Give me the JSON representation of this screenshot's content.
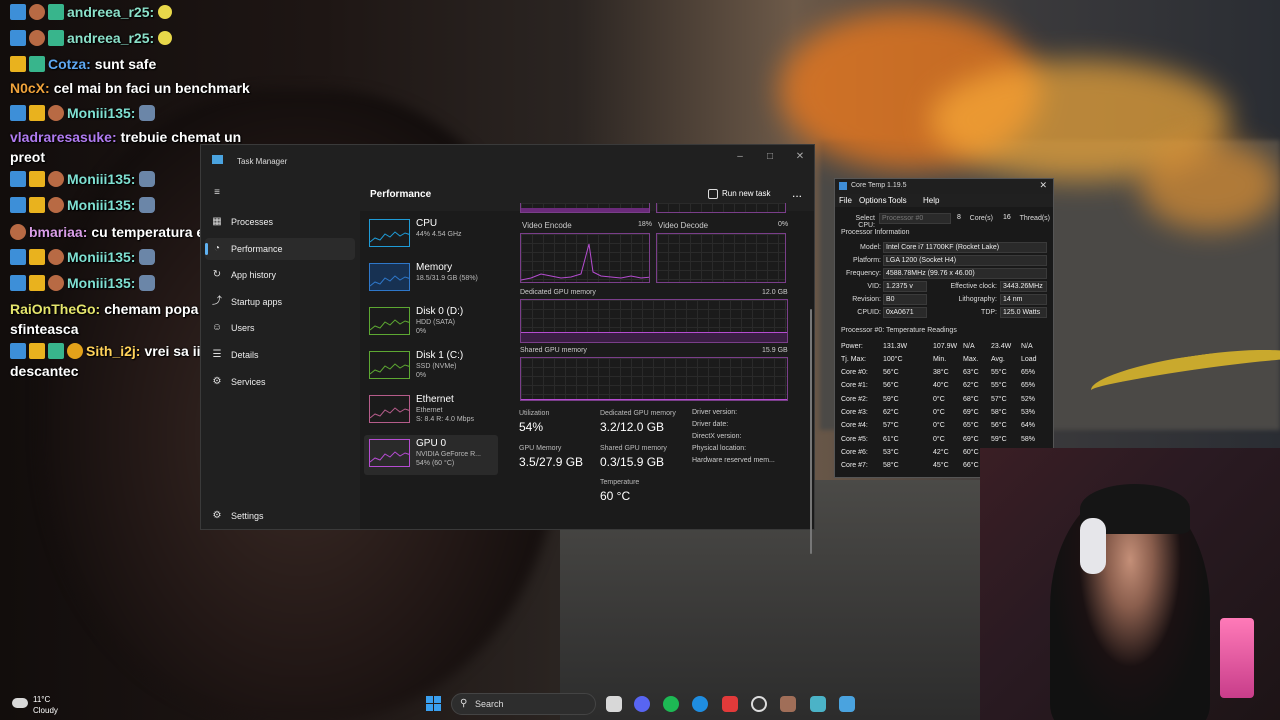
{
  "chat": [
    {
      "badges": [
        "prime",
        "emote",
        "green"
      ],
      "user": "andreea_r25:",
      "user_color": "#8be0c9",
      "text": "",
      "emoji": "smile"
    },
    {
      "badges": [
        "prime",
        "emote",
        "green"
      ],
      "user": "andreea_r25:",
      "user_color": "#8be0c9",
      "text": "",
      "emoji": "smile"
    },
    {
      "badges": [
        "crown",
        "green"
      ],
      "user": "Cotza:",
      "user_color": "#5ea8f2",
      "text": "sunt safe"
    },
    {
      "badges": [],
      "user": "N0cX:",
      "user_color": "#f0a33b",
      "text": "cel mai bn faci un benchmark"
    },
    {
      "badges": [
        "prime",
        "crown",
        "emote"
      ],
      "user": "Moniii135:",
      "user_color": "#7fe0d2",
      "text": "",
      "emoji": "ghost"
    },
    {
      "badges": [],
      "user": "vladraresasuke:",
      "user_color": "#b07bf0",
      "text": "trebuie chemat un preot"
    },
    {
      "badges": [
        "prime",
        "crown",
        "emote"
      ],
      "user": "Moniii135:",
      "user_color": "#7fe0d2",
      "text": "",
      "emoji": "ghost"
    },
    {
      "badges": [
        "prime",
        "crown",
        "emote"
      ],
      "user": "Moniii135:",
      "user_color": "#7fe0d2",
      "text": "",
      "emoji": "ghost"
    },
    {
      "badges": [
        "emote"
      ],
      "user": "bmariaa:",
      "user_color": "#d99de7",
      "text": "cu temperatura e bine"
    },
    {
      "badges": [
        "prime",
        "crown",
        "emote"
      ],
      "user": "Moniii135:",
      "user_color": "#7fe0d2",
      "text": "",
      "emoji": "ghost"
    },
    {
      "badges": [
        "prime",
        "crown",
        "emote"
      ],
      "user": "Moniii135:",
      "user_color": "#7fe0d2",
      "text": "",
      "emoji": "ghost"
    },
    {
      "badges": [],
      "user": "RaiOnTheGo:",
      "user_color": "#e5e56c",
      "text": "chemam popa să îl sfinteasca"
    },
    {
      "badges": [
        "prime",
        "crown",
        "green",
        "coin"
      ],
      "user": "Sith_i2j:",
      "user_color": "#ffd25a",
      "text": "vrei sa ii fac descantec"
    }
  ],
  "taskmanager": {
    "title": "Task Manager",
    "header": "Performance",
    "run_new_task": "Run new task",
    "more": "...",
    "nav": [
      {
        "label": "Processes",
        "icon": "processes-icon"
      },
      {
        "label": "Performance",
        "icon": "performance-icon"
      },
      {
        "label": "App history",
        "icon": "history-icon"
      },
      {
        "label": "Startup apps",
        "icon": "startup-icon"
      },
      {
        "label": "Users",
        "icon": "users-icon"
      },
      {
        "label": "Details",
        "icon": "details-icon"
      },
      {
        "label": "Services",
        "icon": "services-icon"
      }
    ],
    "settings": "Settings",
    "perf_items": [
      {
        "name": "CPU",
        "l2": "44% 4.54 GHz",
        "l3": "",
        "color": "#1f9bd6"
      },
      {
        "name": "Memory",
        "l2": "18.5/31.9 GB (58%)",
        "l3": "",
        "color": "#2e77c9"
      },
      {
        "name": "Disk 0 (D:)",
        "l2": "HDD (SATA)",
        "l3": "0%",
        "color": "#5da832"
      },
      {
        "name": "Disk 1 (C:)",
        "l2": "SSD (NVMe)",
        "l3": "0%",
        "color": "#5da832"
      },
      {
        "name": "Ethernet",
        "l2": "Ethernet",
        "l3": "S: 8.4 R: 4.0 Mbps",
        "color": "#b55c8a"
      },
      {
        "name": "GPU 0",
        "l2": "NVIDIA GeForce R...",
        "l3": "54% (60 °C)",
        "color": "#b54cd1"
      }
    ],
    "video_encode_label": "Video Encode",
    "video_encode_pct": "18%",
    "video_decode_label": "Video Decode",
    "video_decode_pct": "0%",
    "dedicated_label": "Dedicated GPU memory",
    "dedicated_max": "12.0 GB",
    "shared_label": "Shared GPU memory",
    "shared_max": "15.9 GB",
    "stats": {
      "utilization_label": "Utilization",
      "utilization": "54%",
      "dedicated_label": "Dedicated GPU memory",
      "dedicated": "3.2/12.0 GB",
      "gpu_memory_label": "GPU Memory",
      "gpu_memory": "3.5/27.9 GB",
      "shared_label": "Shared GPU memory",
      "shared": "0.3/15.9 GB",
      "temperature_label": "Temperature",
      "temperature": "60 °C"
    },
    "info": [
      "Driver version:",
      "Driver date:",
      "DirectX version:",
      "Physical location:",
      "Hardware reserved mem..."
    ]
  },
  "coretemp": {
    "title": "Core Temp 1.19.5",
    "menu": [
      "File",
      "Options",
      "Tools",
      "Help"
    ],
    "select_cpu": "Select CPU:",
    "processor_sel": "Processor #0",
    "cores": "8",
    "cores_label": "Core(s)",
    "threads": "16",
    "threads_label": "Thread(s)",
    "info_section": "Processor Information",
    "model_label": "Model:",
    "model": "Intel Core i7 11700KF (Rocket Lake)",
    "platform_label": "Platform:",
    "platform": "LGA 1200 (Socket H4)",
    "frequency_label": "Frequency:",
    "frequency": "4588.78MHz (99.76 x 46.00)",
    "vid_label": "VID:",
    "vid": "1.2375 v",
    "eclock_label": "Effective clock:",
    "eclock": "3443.26MHz",
    "revision_label": "Revision:",
    "revision": "B0",
    "litho_label": "Lithography:",
    "litho": "14 nm",
    "cpuid_label": "CPUID:",
    "cpuid": "0xA0671",
    "tdp_label": "TDP:",
    "tdp": "125.0 Watts",
    "temp_section": "Processor #0: Temperature Readings",
    "power_label": "Power:",
    "power": [
      "131.3W",
      "107.9W",
      "N/A",
      "23.4W",
      "N/A"
    ],
    "tjmax_label": "Tj. Max:",
    "tjmax": "100°C",
    "cols": [
      "Min.",
      "Max.",
      "Avg.",
      "Load"
    ],
    "cores_rows": [
      [
        "Core #0:",
        "56°C",
        "38°C",
        "63°C",
        "55°C",
        "65%"
      ],
      [
        "Core #1:",
        "56°C",
        "40°C",
        "62°C",
        "55°C",
        "65%"
      ],
      [
        "Core #2:",
        "59°C",
        "0°C",
        "68°C",
        "57°C",
        "52%"
      ],
      [
        "Core #3:",
        "62°C",
        "0°C",
        "69°C",
        "58°C",
        "53%"
      ],
      [
        "Core #4:",
        "57°C",
        "0°C",
        "65°C",
        "56°C",
        "64%"
      ],
      [
        "Core #5:",
        "61°C",
        "0°C",
        "69°C",
        "59°C",
        "58%"
      ],
      [
        "Core #6:",
        "53°C",
        "42°C",
        "60°C",
        "",
        ""
      ],
      [
        "Core #7:",
        "58°C",
        "45°C",
        "66°C",
        "",
        ""
      ]
    ]
  },
  "taskbar": {
    "temp": "11°C",
    "condition": "Cloudy",
    "search": "Search"
  }
}
